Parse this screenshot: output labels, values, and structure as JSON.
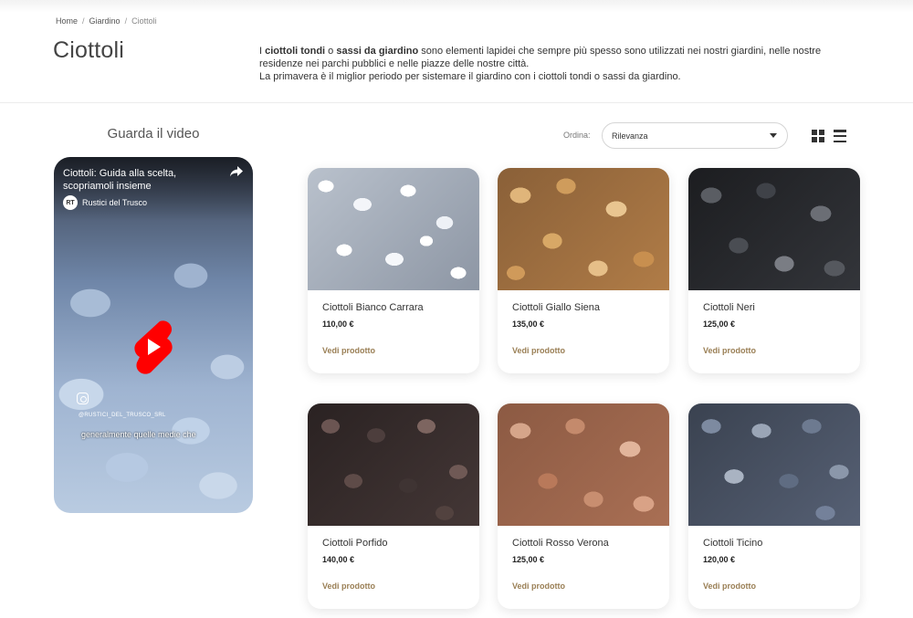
{
  "breadcrumb": {
    "home": "Home",
    "parent": "Giardino",
    "current": "Ciottoli",
    "separator": "/"
  },
  "page": {
    "title": "Ciottoli",
    "intro": {
      "p1_b1": "ciottoli tondi",
      "p1_a": "I ",
      "p1_b": " o ",
      "p1_b2": "sassi da giardino",
      "p1_c": " sono elementi lapidei che sempre più spesso sono utilizzati nei nostri giardini, nelle nostre residenze nei parchi pubblici e nelle piazze delle nostre città.",
      "p2": "La primavera è il miglior periodo per sistemare il giardino con i ciottoli tondi o sassi da giardino."
    }
  },
  "video": {
    "heading": "Guarda il video",
    "title": "Ciottoli: Guida alla scelta, scopriamoli insieme",
    "channel": "Rustici del Trusco",
    "channel_initials": "RT",
    "handle": "@RUSTICI_DEL_TRUSCO_SRL",
    "caption": "generalmente quelle medie che"
  },
  "sort": {
    "label": "Ordina:",
    "selected": "Rilevanza"
  },
  "view_toggle": {
    "grid": "grid-view-icon",
    "list": "list-view-icon"
  },
  "products": [
    {
      "name": "Ciottoli Bianco Carrara",
      "price": "110,00 €",
      "link": "Vedi prodotto"
    },
    {
      "name": "Ciottoli Giallo Siena",
      "price": "135,00 €",
      "link": "Vedi prodotto"
    },
    {
      "name": "Ciottoli Neri",
      "price": "125,00 €",
      "link": "Vedi prodotto"
    },
    {
      "name": "Ciottoli Porfido",
      "price": "140,00 €",
      "link": "Vedi prodotto"
    },
    {
      "name": "Ciottoli Rosso Verona",
      "price": "125,00 €",
      "link": "Vedi prodotto"
    },
    {
      "name": "Ciottoli Ticino",
      "price": "120,00 €",
      "link": "Vedi prodotto"
    }
  ],
  "colors": {
    "accent_link": "#9a7f55",
    "play_red": "#ff0000"
  }
}
